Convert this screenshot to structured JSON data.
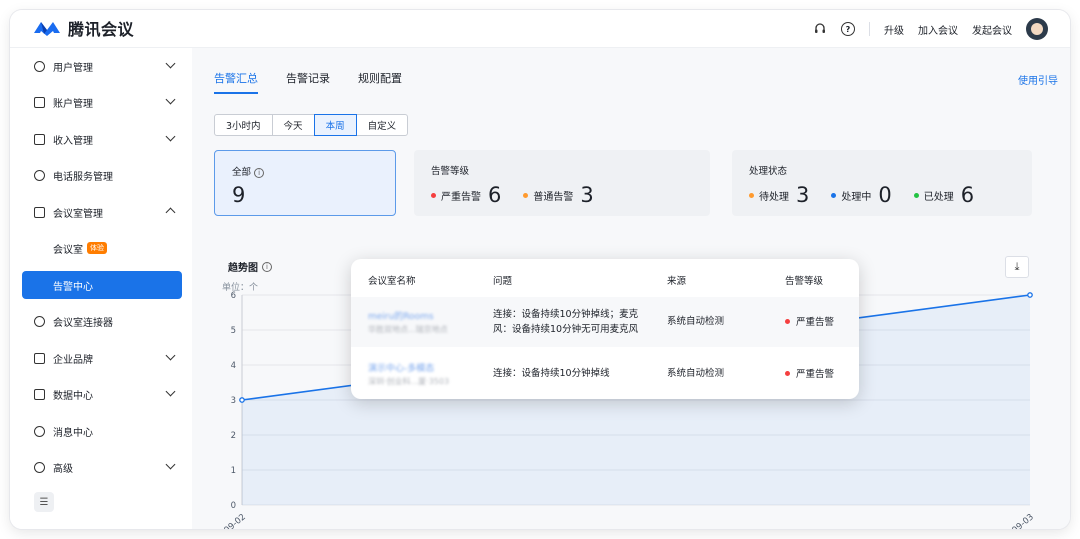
{
  "header": {
    "app_title": "腾讯会议",
    "upgrade": "升级",
    "join": "加入会议",
    "start": "发起会议",
    "help_glyph": "?"
  },
  "sidebar": {
    "items": [
      {
        "label": "用户管理",
        "icon": "user-icon"
      },
      {
        "label": "账户管理",
        "icon": "card-icon"
      },
      {
        "label": "收入管理",
        "icon": "wallet-icon"
      },
      {
        "label": "电话服务管理",
        "icon": "phone-icon"
      },
      {
        "label": "会议室管理",
        "icon": "meeting-room-icon"
      },
      {
        "label": "会议室",
        "tag": "体验"
      },
      {
        "label": "告警中心"
      },
      {
        "label": "会议室连接器",
        "icon": "link-icon"
      },
      {
        "label": "企业品牌",
        "icon": "brand-icon"
      },
      {
        "label": "数据中心",
        "icon": "data-icon"
      },
      {
        "label": "消息中心",
        "icon": "bell-icon"
      },
      {
        "label": "高级",
        "icon": "advanced-icon"
      }
    ]
  },
  "main": {
    "tabs": [
      "告警汇总",
      "告警记录",
      "规则配置"
    ],
    "guide": "使用引导",
    "ranges": [
      "3小时内",
      "今天",
      "本周",
      "自定义"
    ],
    "total": {
      "label": "全部",
      "value": "9"
    },
    "level": {
      "label": "告警等级",
      "items": [
        {
          "name": "严重告警",
          "value": "6",
          "color": "#f53f3f"
        },
        {
          "name": "普通告警",
          "value": "3",
          "color": "#ff9a2e"
        }
      ]
    },
    "state": {
      "label": "处理状态",
      "items": [
        {
          "name": "待处理",
          "value": "3",
          "color": "#ff9a2e"
        },
        {
          "name": "处理中",
          "value": "0",
          "color": "#1a73e8"
        },
        {
          "name": "已处理",
          "value": "6",
          "color": "#23c343"
        }
      ]
    },
    "chart_title": "趋势图",
    "unit": "单位：个"
  },
  "chart_data": {
    "type": "area",
    "x": [
      "09-02",
      "09-03"
    ],
    "series": [
      {
        "values": [
          3,
          6
        ]
      }
    ],
    "ylim": [
      0,
      6
    ],
    "yticks": [
      "0",
      "1",
      "2",
      "3",
      "4",
      "5",
      "6"
    ],
    "color": "#1a73e8",
    "grid": true
  },
  "popup": {
    "headers": [
      "会议室名称",
      "问题",
      "来源",
      "告警等级"
    ],
    "rows": [
      {
        "name": "meiru的Rooms",
        "location": "华胜双地点...瑞京地点",
        "issue_line1": "连接：设备持续10分钟掉线；麦克",
        "issue_line2": "风：设备持续10分钟无可用麦克风",
        "source": "系统自动检测",
        "level": "严重告警"
      },
      {
        "name": "演示中心-多模态",
        "location": "深圳·创业科...厦·3503",
        "issue_line1": "连接：设备持续10分钟掉线",
        "issue_line2": "",
        "source": "系统自动检测",
        "level": "严重告警"
      }
    ],
    "severity_color": "#f53f3f"
  }
}
